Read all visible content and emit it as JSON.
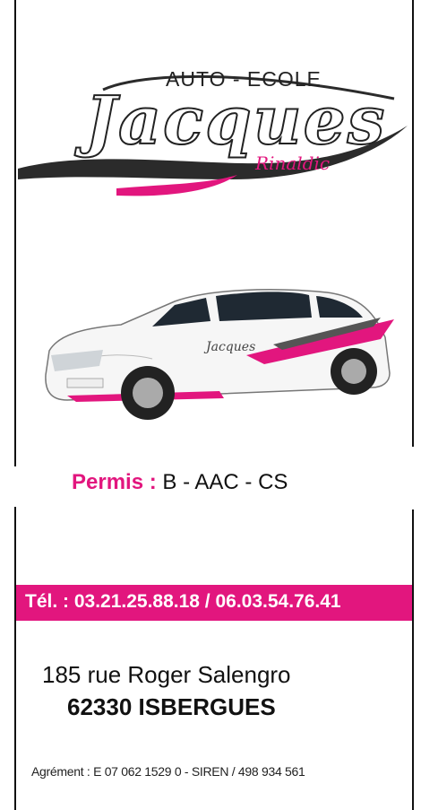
{
  "logo": {
    "top_line": "AUTO - ECOLE",
    "script_name": "Jacques",
    "sub_name": "Rinaldic"
  },
  "car": {
    "door_label": "Jacques"
  },
  "permis": {
    "label": "Permis :",
    "value": " B - AAC - CS"
  },
  "contact": {
    "tel": "Tél. : 03.21.25.88.18 / 06.03.54.76.41",
    "address_line1": "185 rue Roger Salengro",
    "address_line2": "62330 ISBERGUES",
    "agrement": "Agrément : E 07 062 1529 0 - SIREN / 498 934 561"
  },
  "colors": {
    "accent": "#e2167e",
    "text": "#111111",
    "background": "#ffffff"
  }
}
